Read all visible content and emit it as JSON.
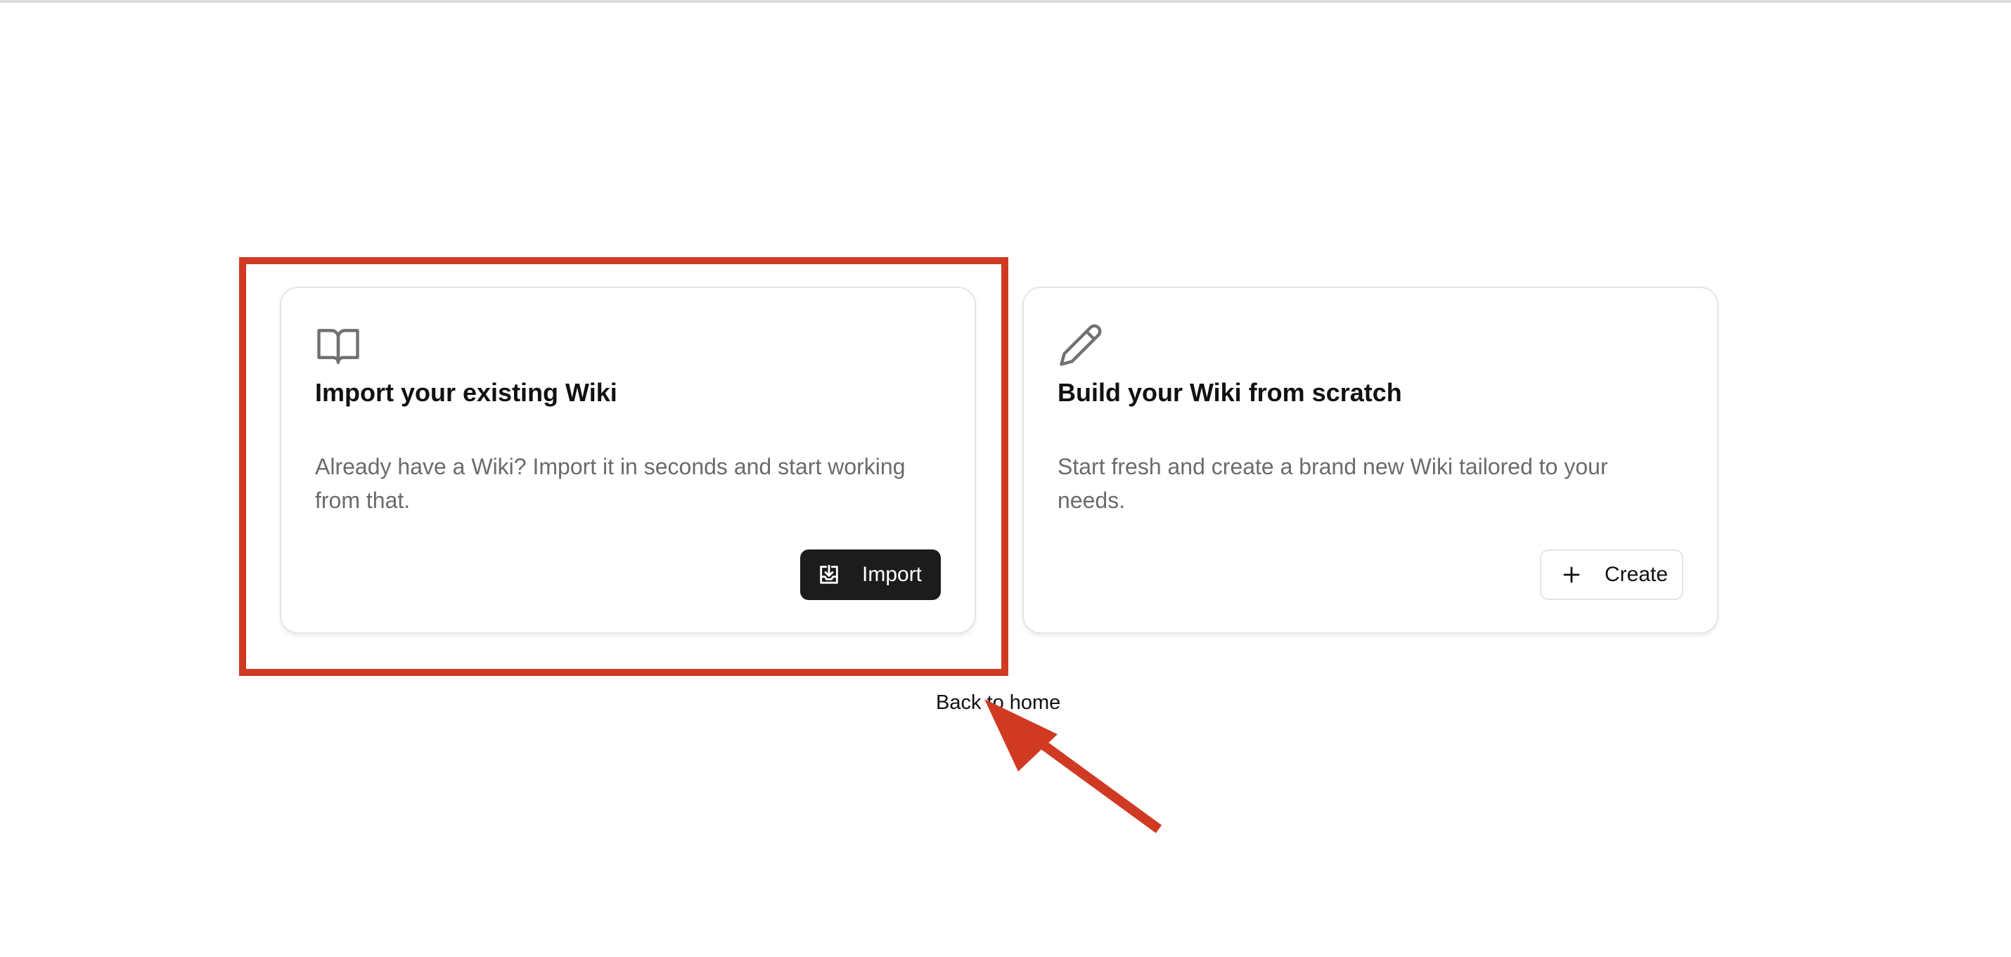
{
  "cards": [
    {
      "icon": "open-book-icon",
      "title": "Import your existing Wiki",
      "description": "Already have a Wiki? Import it in seconds and start working from that.",
      "button": {
        "label": "Import",
        "icon": "download-tray-icon"
      }
    },
    {
      "icon": "pencil-icon",
      "title": "Build your Wiki from scratch",
      "description": "Start fresh and create a brand new Wiki tailored to your needs.",
      "button": {
        "label": "Create",
        "icon": "plus-icon"
      }
    }
  ],
  "back_link": "Back to home",
  "annotation": {
    "highlight_color": "#d03a23",
    "highlights": "import-card",
    "arrow_points_to": "back-to-home-link"
  },
  "colors": {
    "primary_button_bg": "#1c1c1c",
    "muted_text": "#6b6b6b",
    "card_border": "#e5e5e5"
  }
}
